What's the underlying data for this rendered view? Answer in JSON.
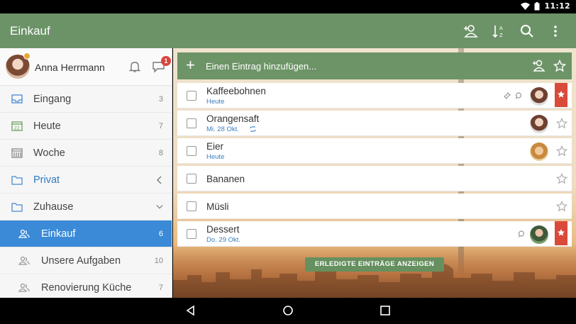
{
  "status_bar": {
    "time": "11:12"
  },
  "app_bar": {
    "title": "Einkauf",
    "actions": [
      "add-member-icon",
      "sort-icon",
      "search-icon",
      "more-icon"
    ]
  },
  "profile": {
    "name": "Anna Herrmann",
    "notification_count": "1"
  },
  "sidebar": {
    "items": [
      {
        "label": "Eingang",
        "count": "3",
        "icon": "inbox-icon"
      },
      {
        "label": "Heute",
        "count": "7",
        "icon": "today-icon"
      },
      {
        "label": "Woche",
        "count": "8",
        "icon": "week-icon"
      },
      {
        "label": "Privat",
        "count": "",
        "icon": "folder-icon"
      },
      {
        "label": "Zuhause",
        "count": "",
        "icon": "folder-icon"
      },
      {
        "label": "Einkauf",
        "count": "6",
        "icon": "shared-list-icon"
      },
      {
        "label": "Unsere Aufgaben",
        "count": "10",
        "icon": "shared-list-icon"
      },
      {
        "label": "Renovierung Küche",
        "count": "7",
        "icon": "shared-list-icon"
      }
    ]
  },
  "add_bar": {
    "placeholder": "Einen Eintrag hinzufügen..."
  },
  "tasks": [
    {
      "title": "Kaffeebohnen",
      "sub": "Heute",
      "starred": true
    },
    {
      "title": "Orangensaft",
      "sub": "Mi. 28 Okt.",
      "starred": false
    },
    {
      "title": "Eier",
      "sub": "Heute",
      "starred": false
    },
    {
      "title": "Bananen",
      "sub": "",
      "starred": false
    },
    {
      "title": "Müsli",
      "sub": "",
      "starred": false
    },
    {
      "title": "Dessert",
      "sub": "Do. 29 Okt.",
      "starred": true
    }
  ],
  "completed_button": "ERLEDIGTE EINTRÄGE ANZEIGEN",
  "colors": {
    "app_bar": "#6c9368",
    "active_item": "#3a8ad7",
    "due_text": "#3a7cc0",
    "star_ribbon": "#d94a3a",
    "badge": "#d9463c"
  }
}
